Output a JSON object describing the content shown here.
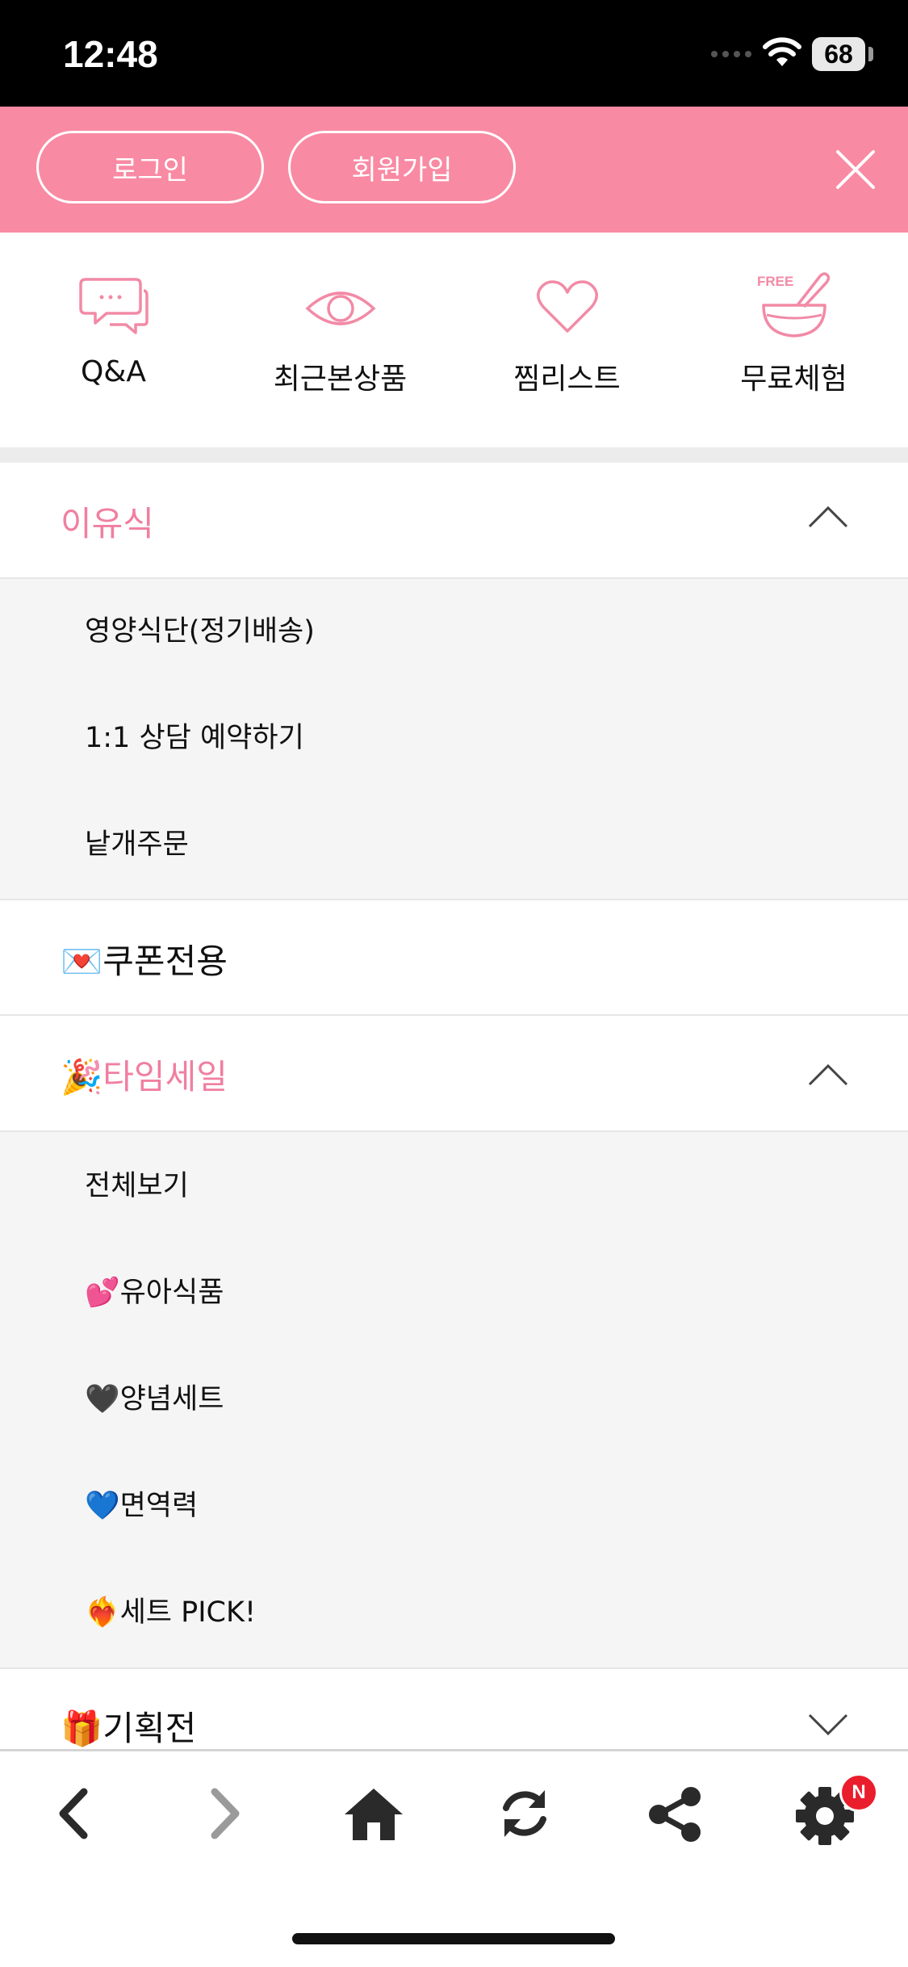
{
  "status_bar": {
    "time": "12:48",
    "battery": "68"
  },
  "header": {
    "login_label": "로그인",
    "join_label": "회원가입"
  },
  "quick_links": [
    {
      "label": "Q&A",
      "icon": "chat-bubbles-icon"
    },
    {
      "label": "최근본상품",
      "icon": "eye-icon"
    },
    {
      "label": "찜리스트",
      "icon": "heart-icon"
    },
    {
      "label": "무료체험",
      "icon": "free-bowl-icon",
      "icon_text": "FREE"
    }
  ],
  "menu": {
    "baby_food": {
      "label": "이유식",
      "expanded": true,
      "items": [
        "영양식단(정기배송)",
        "1:1 상담 예약하기",
        "낱개주문"
      ]
    },
    "coupon": {
      "emoji": "💌",
      "label": "쿠폰전용"
    },
    "time_sale": {
      "emoji": "🎉",
      "label": "타임세일",
      "expanded": true,
      "items": [
        {
          "emoji": "",
          "label": "전체보기"
        },
        {
          "emoji": "💕",
          "label": "유아식품"
        },
        {
          "emoji": "🖤",
          "label": "양념세트"
        },
        {
          "emoji": "💙",
          "label": "면역력"
        },
        {
          "emoji": "❤️‍🔥",
          "label": "세트 PICK!"
        }
      ]
    },
    "special": {
      "emoji": "🎁",
      "label": "기획전",
      "expanded": false
    }
  },
  "toolbar": {
    "settings_badge": "N"
  },
  "colors": {
    "accent_pink": "#f98aa3",
    "menu_pink": "#f07fa0",
    "badge_red": "#ea1d2c"
  }
}
